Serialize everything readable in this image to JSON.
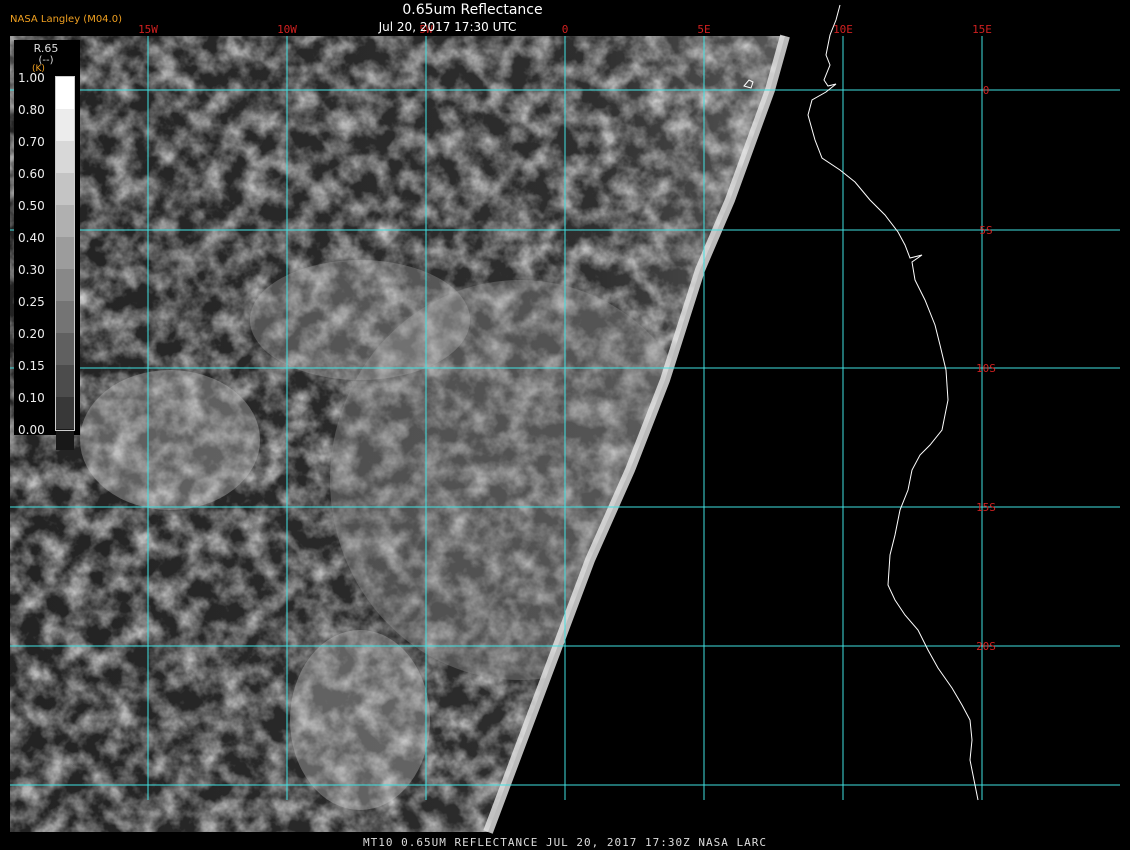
{
  "header": {
    "app_title": "NASA Langley (M04.0)",
    "product_title": "0.65um Reflectance",
    "obs_time": "Jul 20, 2017 17:30 UTC"
  },
  "footer": {
    "caption": "MT10  0.65UM REFLECTANCE   JUL 20, 2017 17:30Z   NASA LARC"
  },
  "colorbar": {
    "title": "R.65",
    "units": "(--)",
    "unit_fragment": "(K)",
    "labels": [
      "1.00",
      "0.80",
      "0.70",
      "0.60",
      "0.50",
      "0.40",
      "0.30",
      "0.25",
      "0.20",
      "0.15",
      "0.10",
      "0.00"
    ],
    "shades": [
      "#ffffff",
      "#ececec",
      "#d8d8d8",
      "#c4c4c4",
      "#b0b0b0",
      "#9c9c9c",
      "#888888",
      "#747474",
      "#606060",
      "#4c4c4c",
      "#383838",
      "#181818"
    ]
  },
  "map": {
    "lon_labels": [
      "15W",
      "10W",
      "5W",
      "0",
      "5E",
      "10E",
      "15E"
    ],
    "lat_labels": [
      "0",
      "5S",
      "10S",
      "15S",
      "20S"
    ],
    "grid_color": "#40e0e0",
    "label_color": "#d02020",
    "coast_color": "#ffffff"
  }
}
